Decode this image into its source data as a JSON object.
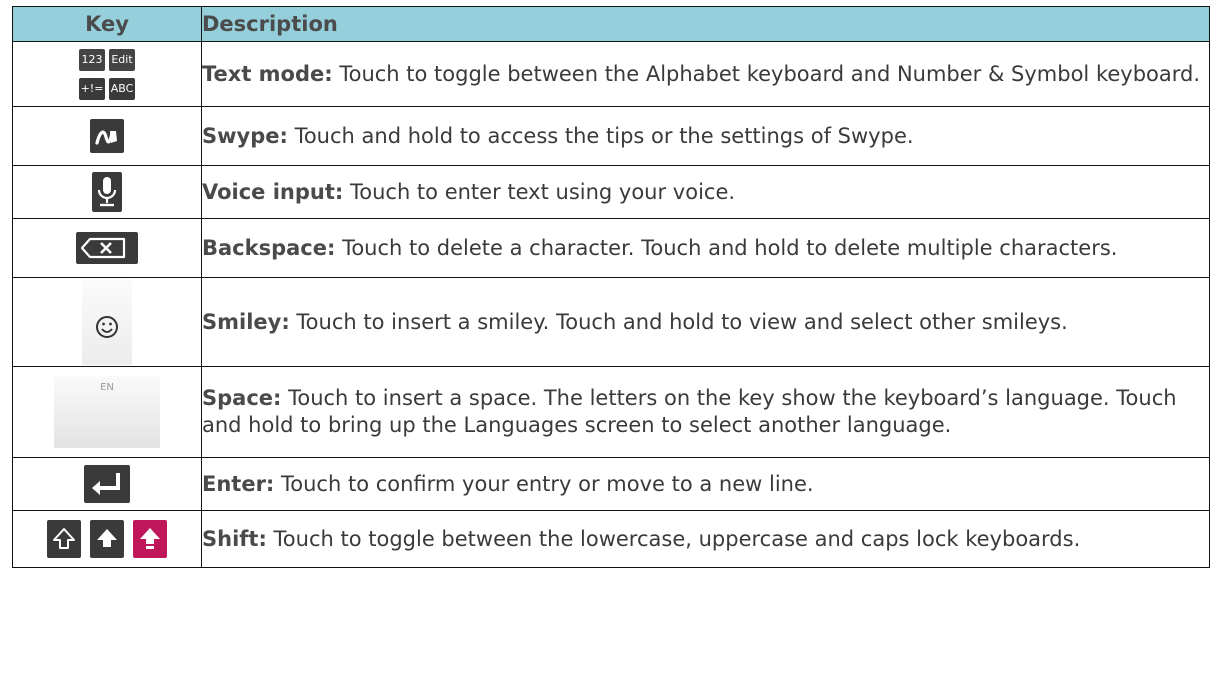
{
  "header": {
    "key": "Key",
    "description": "Description"
  },
  "rows": [
    {
      "icon": "text-mode-keys-icon",
      "icon_labels": [
        "123",
        "Edit",
        "+!=",
        "ABC"
      ],
      "term": "Text mode:",
      "desc": " Touch to toggle between the Alphabet keyboard and Number & Symbol keyboard."
    },
    {
      "icon": "swype-key-icon",
      "term": "Swype:",
      "desc": " Touch and hold to access the tips or the settings of Swype."
    },
    {
      "icon": "microphone-icon",
      "term": "Voice input:",
      "desc": " Touch to enter text using your voice."
    },
    {
      "icon": "backspace-icon",
      "term": "Backspace:",
      "desc": " Touch to delete a character. Touch and hold to delete multiple characters."
    },
    {
      "icon": "smiley-icon",
      "term": "Smiley:",
      "desc": " Touch to insert a smiley. Touch and hold to view and select other smileys."
    },
    {
      "icon": "space-key-icon",
      "icon_labels": [
        "EN"
      ],
      "term": "Space:",
      "desc": " Touch to insert a space. The letters on the key show the keyboard’s language. Touch and hold to bring up the Languages screen to select another language."
    },
    {
      "icon": "enter-icon",
      "term": "Enter:",
      "desc": " Touch to confirm your entry or move to a new line."
    },
    {
      "icon": "shift-icons",
      "term": "Shift:",
      "desc": " Touch to toggle between the lowercase, uppercase and caps lock keyboards."
    }
  ],
  "colors": {
    "header_bg": "#94cfdb",
    "key_dark": "#3a3a3a",
    "caps_lock": "#c0175a"
  }
}
